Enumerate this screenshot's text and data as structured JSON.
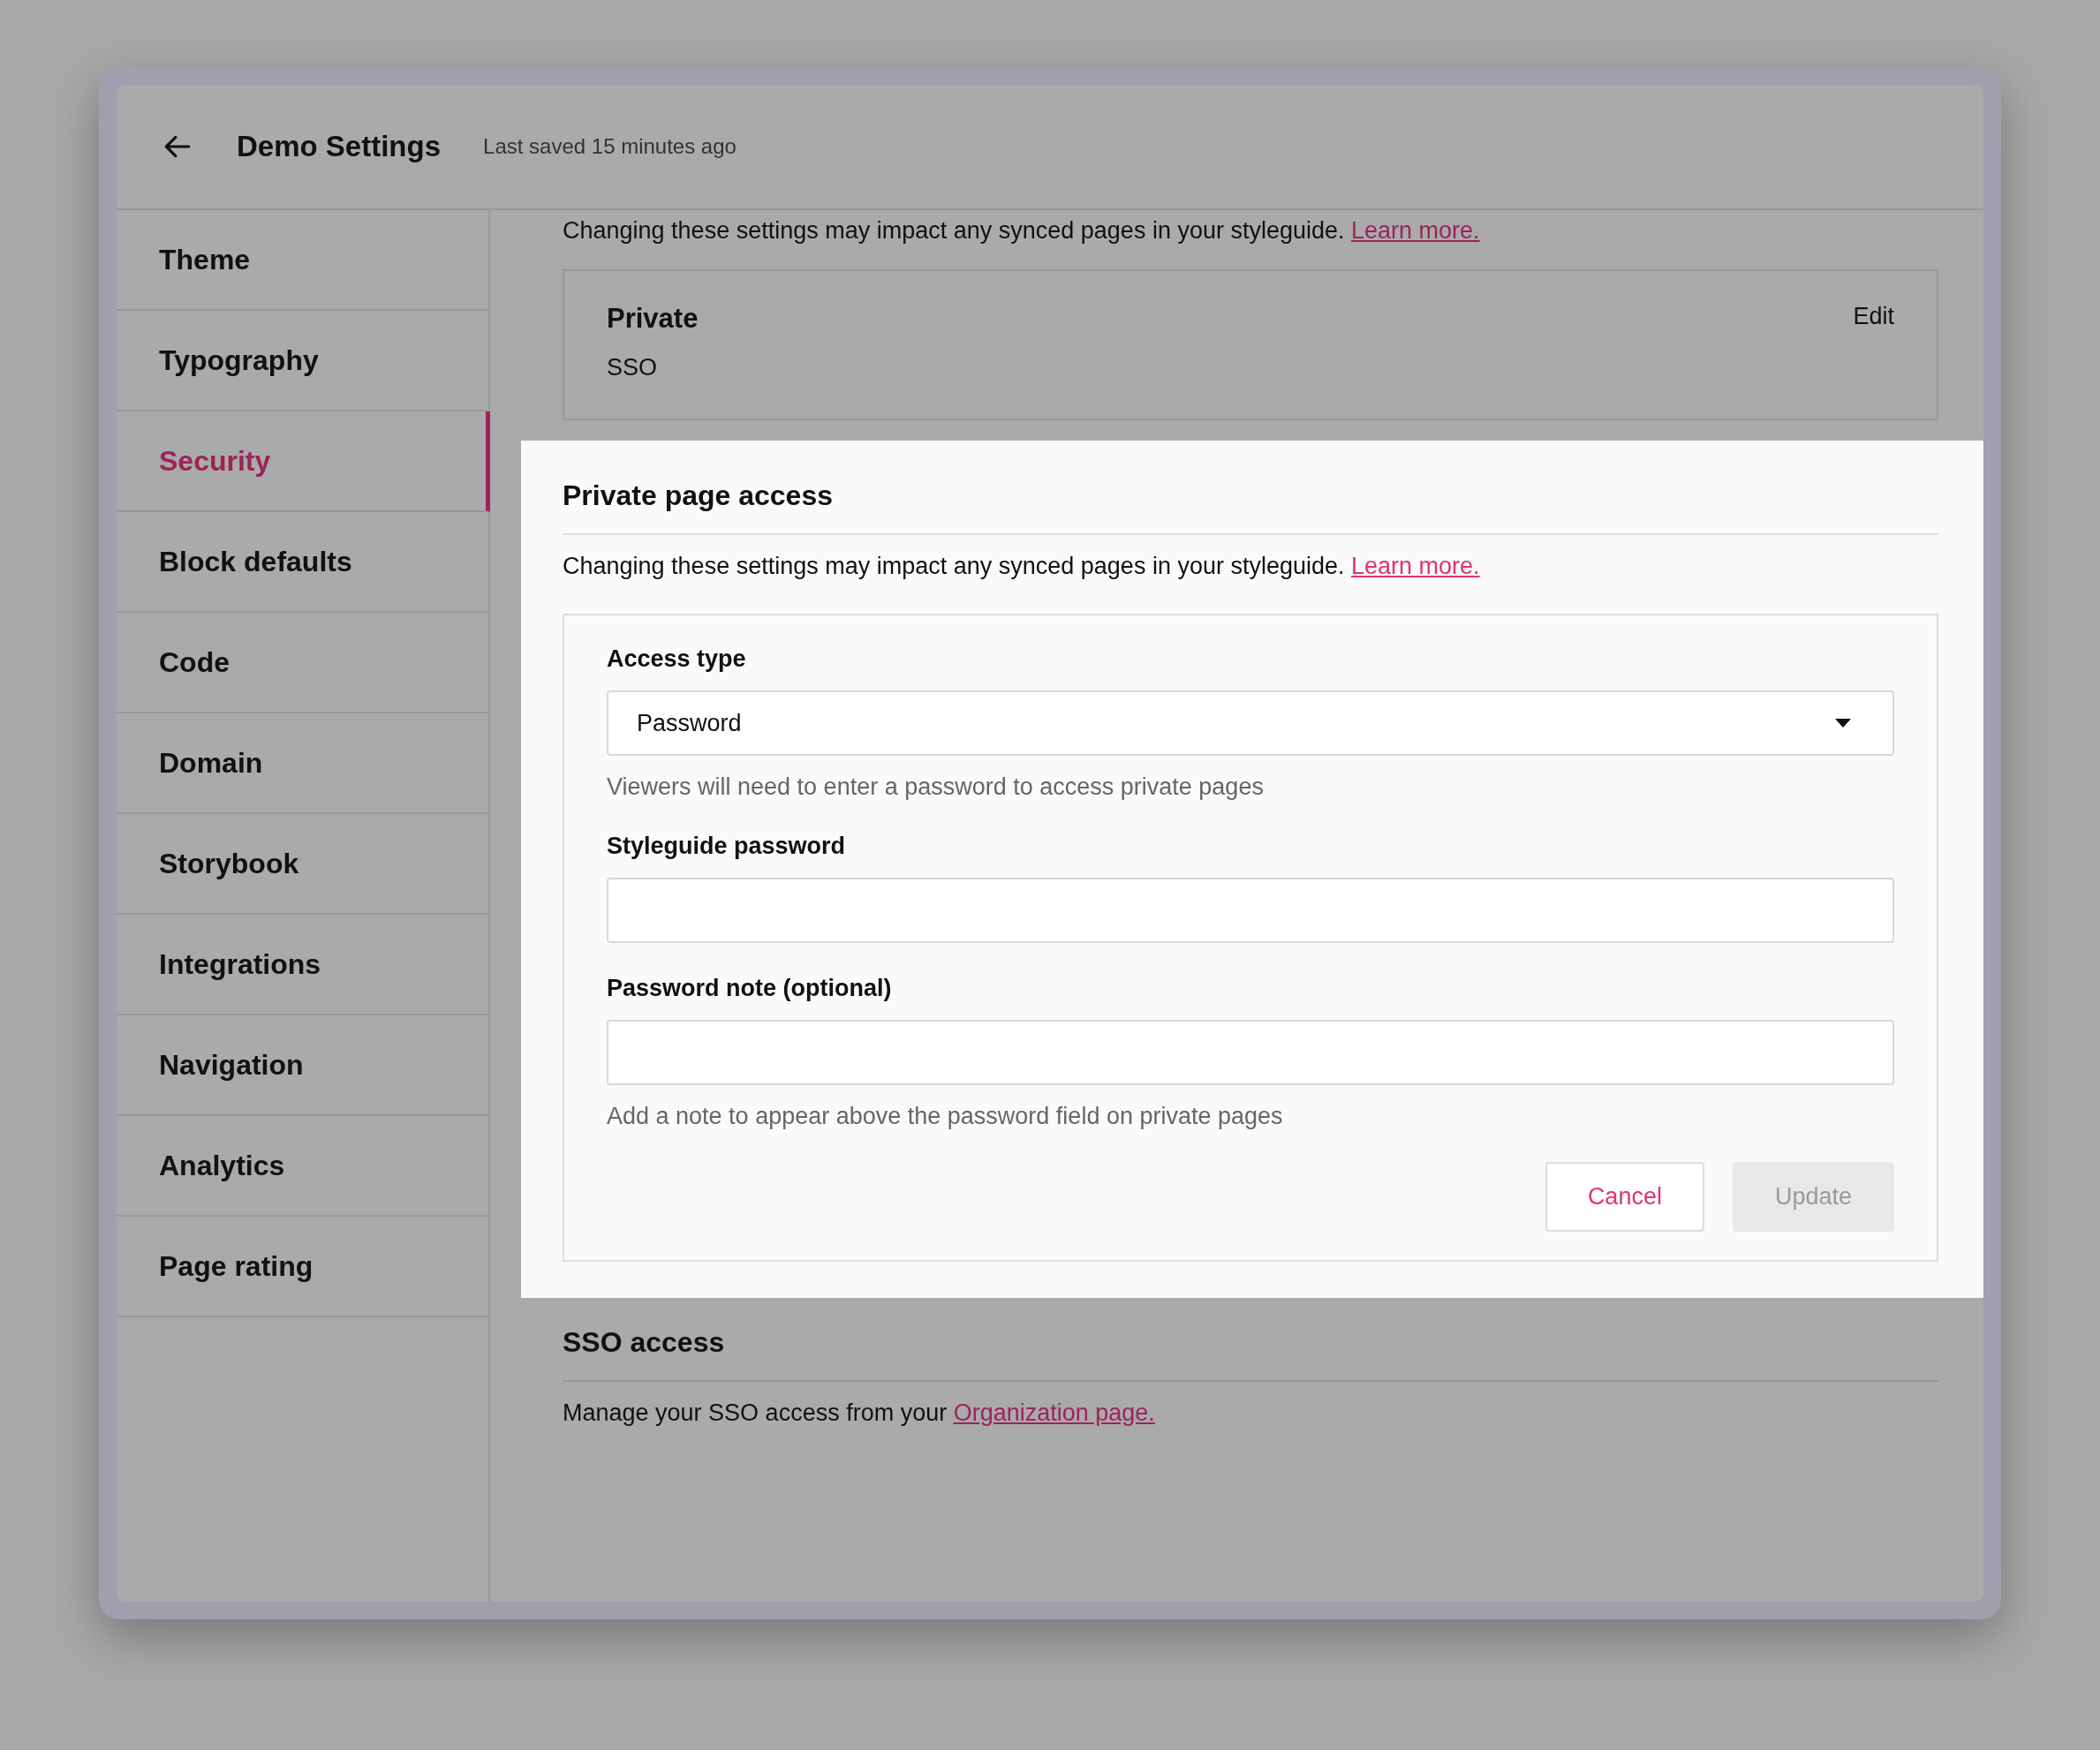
{
  "header": {
    "title": "Demo Settings",
    "status": "Last saved 15 minutes ago"
  },
  "sidebar": {
    "items": [
      {
        "label": "Theme",
        "selected": false
      },
      {
        "label": "Typography",
        "selected": false
      },
      {
        "label": "Security",
        "selected": true
      },
      {
        "label": "Block defaults",
        "selected": false
      },
      {
        "label": "Code",
        "selected": false
      },
      {
        "label": "Domain",
        "selected": false
      },
      {
        "label": "Storybook",
        "selected": false
      },
      {
        "label": "Integrations",
        "selected": false
      },
      {
        "label": "Navigation",
        "selected": false
      },
      {
        "label": "Analytics",
        "selected": false
      },
      {
        "label": "Page rating",
        "selected": false
      }
    ]
  },
  "notice": {
    "text": "Changing these settings may impact any synced pages in your styleguide.",
    "link": "Learn more."
  },
  "private_card": {
    "title": "Private",
    "value": "SSO",
    "action": "Edit"
  },
  "private_page_access": {
    "title": "Private page access",
    "notice": {
      "text": "Changing these settings may impact any synced pages in your styleguide.",
      "link": "Learn more."
    },
    "fields": [
      {
        "kind": "select",
        "label": "Access type",
        "value": "Password",
        "hint": "Viewers will need to enter a password to access private pages"
      },
      {
        "kind": "text",
        "label": "Styleguide password"
      },
      {
        "kind": "text",
        "label": "Password note (optional)",
        "hint": "Add a note to appear above the password field on private pages"
      }
    ],
    "buttons": [
      {
        "label": "Cancel",
        "kind": "secondary",
        "disabled": false
      },
      {
        "label": "Update",
        "kind": "primary",
        "disabled": true
      }
    ]
  },
  "sso_access": {
    "title": "SSO access",
    "text": "Manage your SSO access from your",
    "link": "Organization page."
  }
}
